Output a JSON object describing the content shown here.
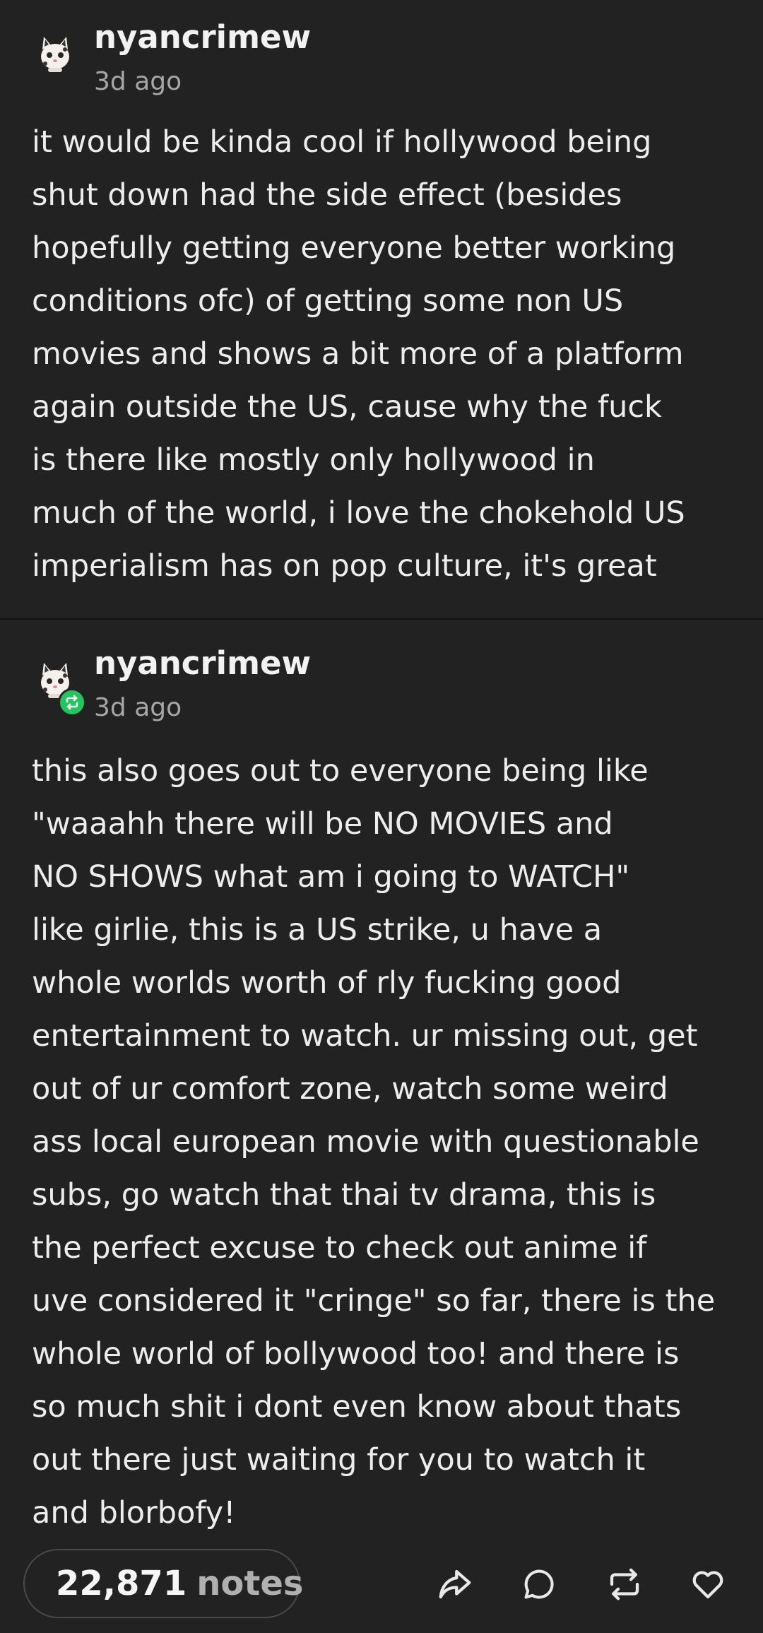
{
  "posts": [
    {
      "username": "nyancrimew",
      "timestamp": "3d ago",
      "avatar_icon": "cat-avatar-icon",
      "reblogged": false,
      "lines": [
        "it would be kinda cool if hollywood being",
        "shut down had the side effect (besides",
        "hopefully getting everyone better working",
        "conditions ofc) of getting some non US",
        "movies and shows a bit more of a platform",
        "again outside the US, cause why the fuck",
        "is there like mostly only hollywood in",
        "much of the world, i love the chokehold US",
        "imperialism has on pop culture, it's great"
      ]
    },
    {
      "username": "nyancrimew",
      "timestamp": "3d ago",
      "avatar_icon": "cat-avatar-icon",
      "reblogged": true,
      "reblog_badge_color": "#22c55e",
      "lines": [
        "this also goes out to everyone being like",
        "\"waaahh there will be NO MOVIES and",
        "NO SHOWS what am i going to WATCH\"",
        "like girlie, this is a US strike, u have a",
        "whole worlds worth of rly fucking good",
        "entertainment to watch. ur missing out, get",
        "out of ur comfort zone, watch some weird",
        "ass local european movie with questionable",
        "subs, go watch that thai tv drama, this is",
        "the perfect excuse to check out anime if",
        "uve considered it \"cringe\" so far, there is the",
        "whole world of bollywood too! and there is",
        "so much shit i dont even know about thats",
        "out there just waiting for you to watch it",
        "and blorbofy!"
      ]
    }
  ],
  "footer": {
    "notes_count": "22,871",
    "notes_label": "notes",
    "actions": [
      "share-icon",
      "reply-icon",
      "reblog-icon",
      "heart-icon"
    ]
  },
  "colors": {
    "background": "#222222",
    "text": "#ededed",
    "muted": "#a7a7a7",
    "divider": "#111111",
    "reblog_green": "#22c55e"
  }
}
